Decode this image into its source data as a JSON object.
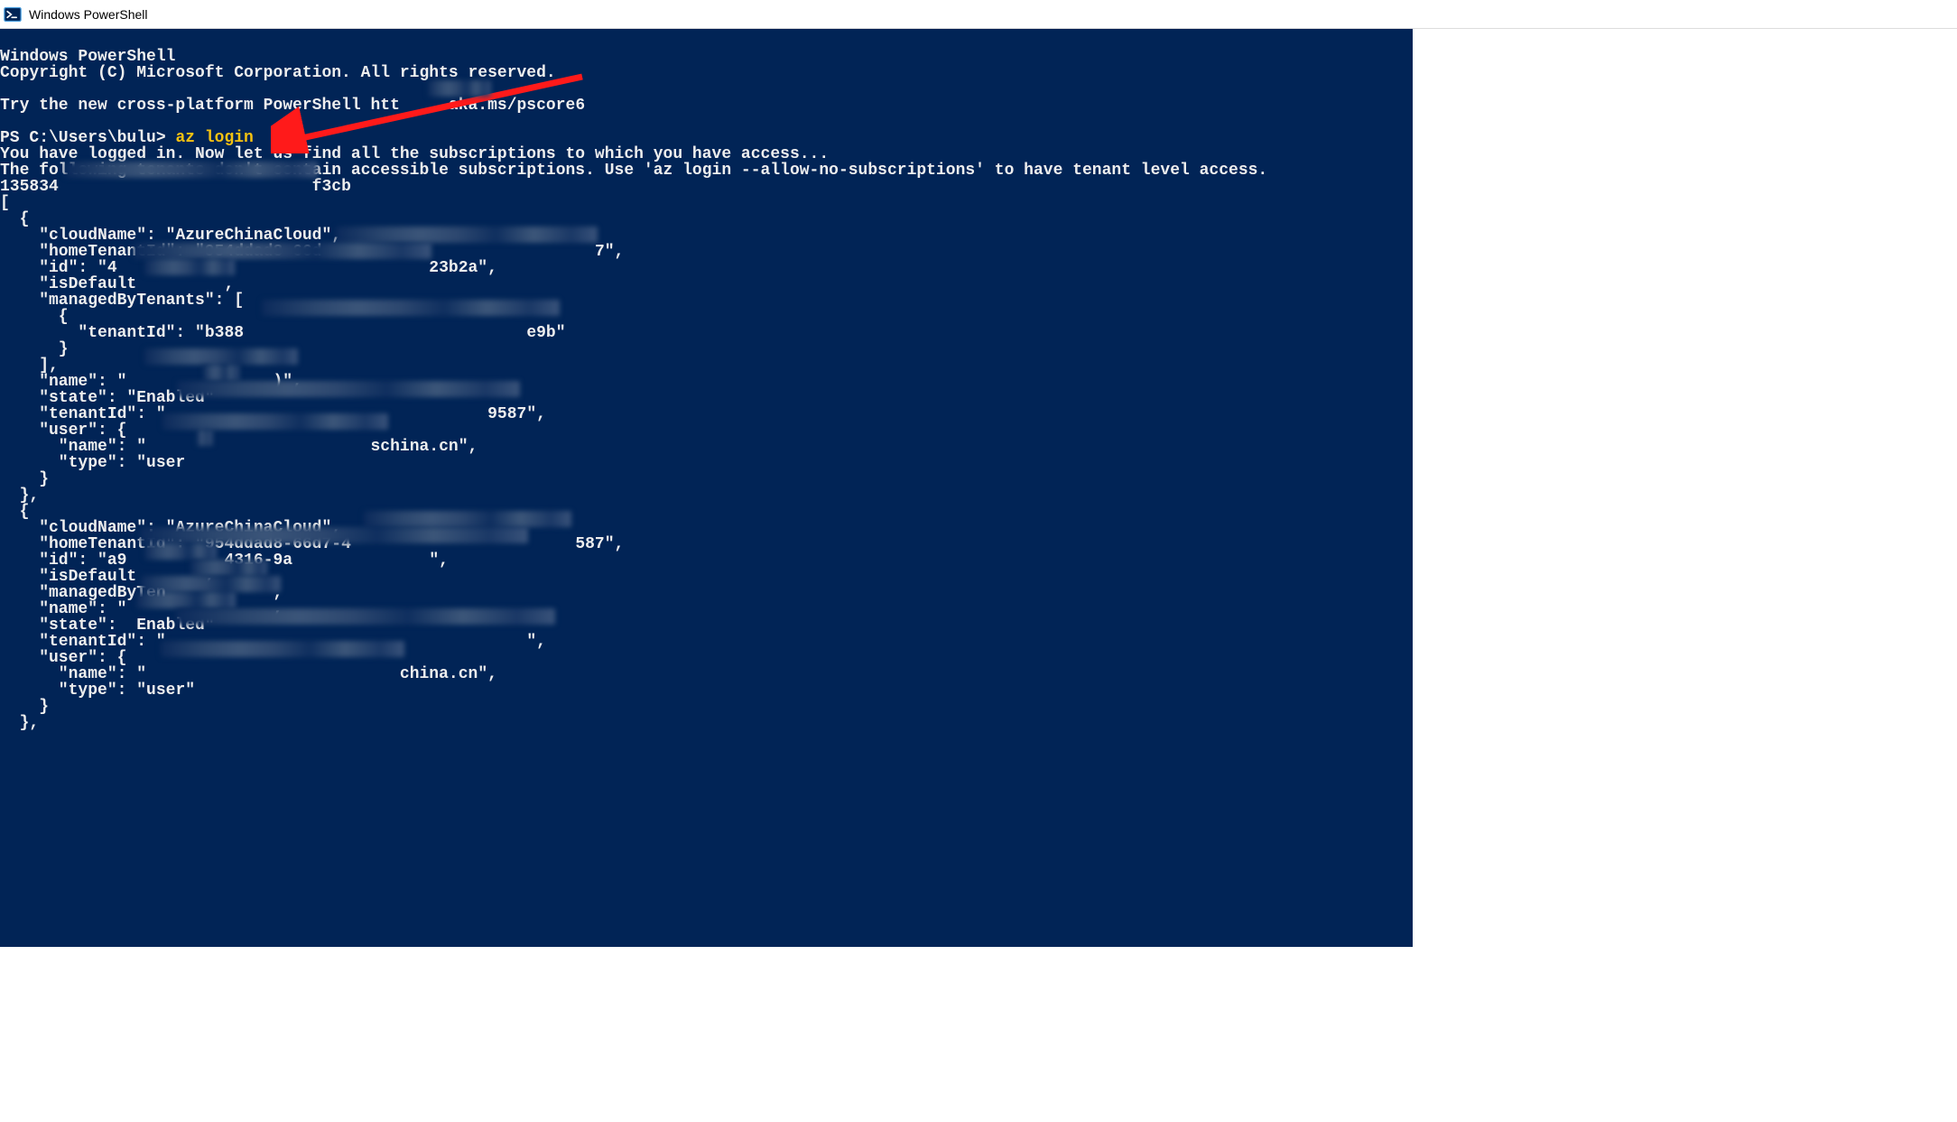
{
  "window": {
    "title": "Windows PowerShell"
  },
  "terminal": {
    "header_line1": "Windows PowerShell",
    "header_line2": "Copyright (C) Microsoft Corporation. All rights reserved.",
    "promo_line": "Try the new cross-platform PowerShell htt",
    "promo_url_part2": "aka.ms/pscore6",
    "prompt_prefix": "PS C:\\Users\\bulu> ",
    "command": "az login",
    "msg_logged_in": "You have logged in. Now let us find all the subscriptions to which you have access...",
    "msg_tenants": "The following tenants don't contain accessible subscriptions. Use 'az login --allow-no-subscriptions' to have tenant level access.",
    "partial_id_start": "135834",
    "partial_id_end": "f3cb",
    "bracket_open": "[",
    "obj1_open": "  {",
    "obj1_cloudname_key": "    \"cloudName\": ",
    "obj1_cloudname_val": "\"AzureChinaCloud\",",
    "obj1_home_key": "    \"homeTenantId\": ",
    "obj1_home_part1": "\"954ddad8-66d",
    "obj1_home_part2": "7\",",
    "obj1_id_key": "    \"id\": ",
    "obj1_id_part1": "\"4",
    "obj1_id_part2": "23b2a\",",
    "obj1_isdef": "    \"isDefault",
    "obj1_isdef_tail": ",",
    "obj1_mbt_key": "    \"managedByTenants\": [",
    "obj1_mbt_open": "      {",
    "obj1_mbt_tenantid_key": "        \"tenantId\": ",
    "obj1_mbt_tenantid_part1": "\"b388",
    "obj1_mbt_tenantid_part2": "e9b\"",
    "obj1_mbt_close": "      }",
    "obj1_mbt_close2": "    ],",
    "obj1_name_key": "    \"name\": ",
    "obj1_name_part1": "\"",
    "obj1_name_part2": ")\",",
    "obj1_state_key": "    \"state\": ",
    "obj1_state_val": "\"Enabled\"",
    "obj1_tenantid_key": "    \"tenantId\": ",
    "obj1_tenantid_part1": "\"",
    "obj1_tenantid_part2": "9587\",",
    "obj1_user_key": "    \"user\": {",
    "obj1_user_name_key": "      \"name\": ",
    "obj1_user_name_part1": "\"",
    "obj1_user_name_part2": "schina.cn\",",
    "obj1_user_type_key": "      \"type\": ",
    "obj1_user_type_val": "\"user",
    "obj1_user_close": "    }",
    "obj1_close": "  },",
    "obj2_open": "  {",
    "obj2_cloudname_key": "    \"cloudName\": ",
    "obj2_cloudname_val": "\"AzureChinaCloud\",",
    "obj2_home_key": "    \"homeTenantId\": ",
    "obj2_home_part1": "\"954ddad8-66d7-4",
    "obj2_home_part2": "587\",",
    "obj2_id_key": "    \"id\": ",
    "obj2_id_part1": "\"a9",
    "obj2_id_mid": "4316-9a",
    "obj2_id_part2": "\",",
    "obj2_isdef": "    \"isDefault",
    "obj2_isdef_tail": ",",
    "obj2_mbt_key": "    \"managedByTen",
    "obj2_mbt_tail": ",",
    "obj2_name_key": "    \"name\": ",
    "obj2_name_part1": "\"",
    "obj2_name_part2": ",",
    "obj2_state_key": "    \"state\": ",
    "obj2_state_val": "Enabled\"",
    "obj2_tenantid_key": "    \"tenantId\": ",
    "obj2_tenantid_part1": "\"",
    "obj2_tenantid_part2": "\",",
    "obj2_user_key": "    \"user\": {",
    "obj2_user_name_key": "      \"name\": ",
    "obj2_user_name_part1": "\"",
    "obj2_user_name_part2": "china.cn\",",
    "obj2_user_type_key": "      \"type\": ",
    "obj2_user_type_val": "\"user\"",
    "obj2_user_close": "    }",
    "obj2_close": "  },"
  }
}
